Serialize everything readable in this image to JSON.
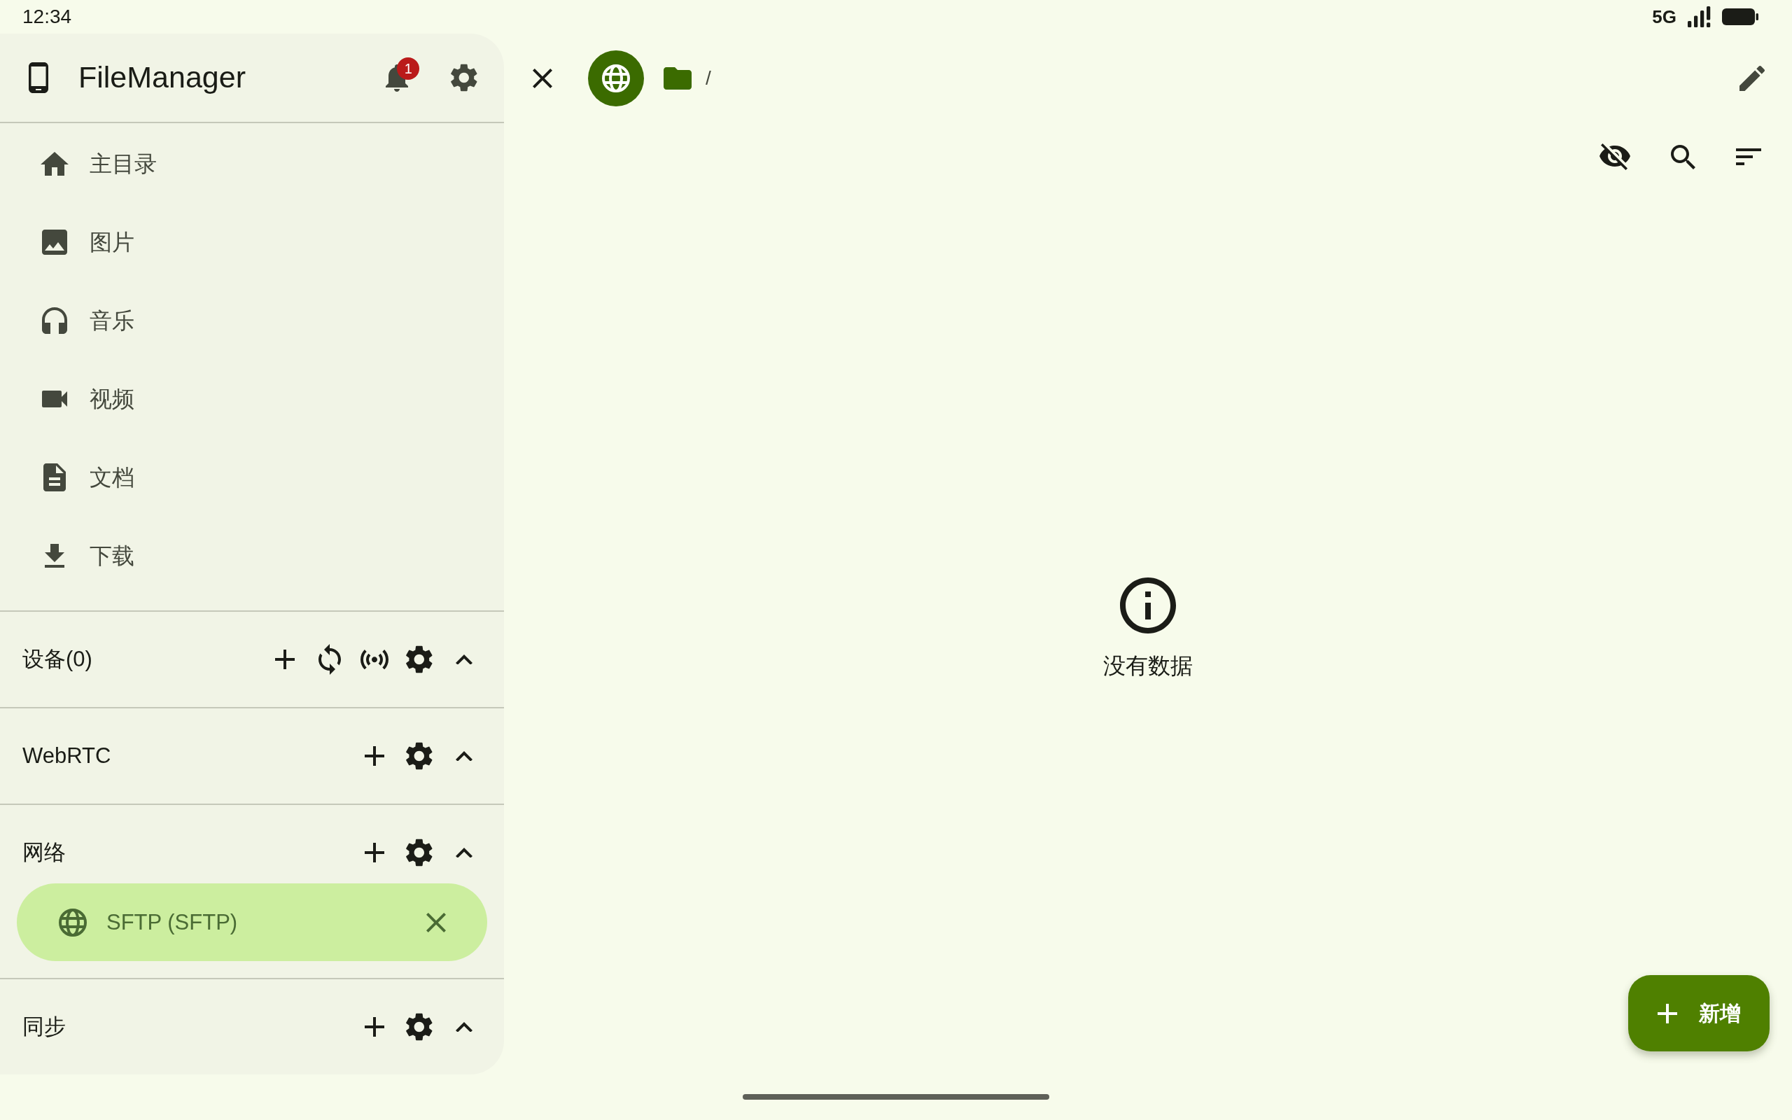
{
  "status_bar": {
    "time": "12:34",
    "network": "5G"
  },
  "sidebar": {
    "title": "FileManager",
    "notification_count": "1",
    "nav_items": [
      {
        "label": "主目录",
        "selected": false
      },
      {
        "label": "图片",
        "selected": false
      },
      {
        "label": "音乐",
        "selected": false
      },
      {
        "label": "视频",
        "selected": false
      },
      {
        "label": "文档",
        "selected": false
      },
      {
        "label": "下载",
        "selected": false
      }
    ],
    "sections": [
      {
        "title": "设备(0)",
        "kind": "discovery",
        "expanded": true
      },
      {
        "title": "WebRTC",
        "kind": "standard",
        "expanded": true
      },
      {
        "title": "网络",
        "kind": "standard",
        "expanded": true,
        "items": [
          {
            "label": "SFTP (SFTP)",
            "selected": true
          }
        ]
      },
      {
        "title": "同步",
        "kind": "standard",
        "expanded": true
      }
    ]
  },
  "toolbar": {
    "path": "/"
  },
  "empty_state": {
    "message": "没有数据"
  },
  "fab": {
    "label": "新增"
  }
}
